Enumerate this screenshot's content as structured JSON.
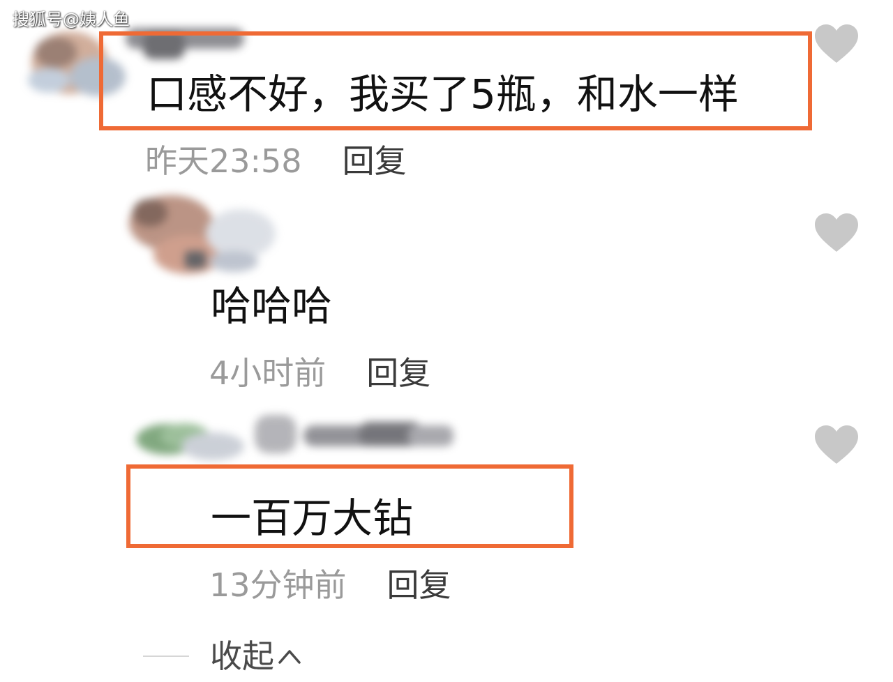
{
  "watermark": "搜狐号@姨人鱼",
  "comments": [
    {
      "text": "口感不好，我买了5瓶，和水一样",
      "time": "昨天23:58",
      "reply": "回复"
    },
    {
      "text": "哈哈哈",
      "time": "4小时前",
      "reply": "回复"
    },
    {
      "text": "一百万大钻",
      "time": "13分钟前",
      "reply": "回复"
    }
  ],
  "collapse_label": "收起",
  "icons": {
    "like": "heart-icon",
    "collapse": "chevron-up-icon"
  },
  "colors": {
    "highlight": "#ef6a35",
    "heart": "#c8c8c8",
    "meta_text": "#9a9a9a",
    "comment_text": "#111111"
  }
}
